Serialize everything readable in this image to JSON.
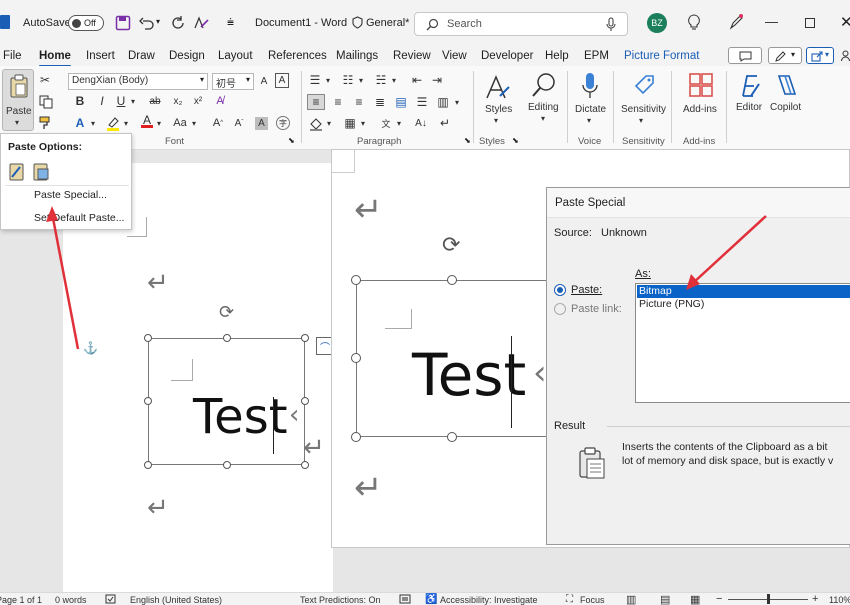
{
  "titlebar": {
    "autosave_label": "AutoSave",
    "autosave_state": "Off",
    "doc_title": "Document1 - Word",
    "sensitivity": "General*",
    "search_placeholder": "Search",
    "avatar_initials": "BZ"
  },
  "menu": {
    "tabs": [
      "File",
      "Home",
      "Insert",
      "Draw",
      "Design",
      "Layout",
      "References",
      "Mailings",
      "Review",
      "View",
      "Developer",
      "Help",
      "EPM",
      "Picture Format"
    ],
    "active_tab": "Home"
  },
  "ribbon": {
    "paste_label": "Paste",
    "font_name": "DengXian (Body)",
    "font_size": "初号",
    "group_font": "Font",
    "group_paragraph": "Paragraph",
    "group_styles": "Styles",
    "group_voice": "Voice",
    "group_sensitivity": "Sensitivity",
    "group_addins": "Add-ins",
    "styles_label": "Styles",
    "editing_label": "Editing",
    "dictate_label": "Dictate",
    "sensitivity_label": "Sensitivity",
    "addins_label": "Add-ins",
    "editor_label": "Editor",
    "copilot_label": "Copilot",
    "format_bold": "B",
    "format_italic": "I",
    "format_underline": "U"
  },
  "paste_menu": {
    "title": "Paste Options:",
    "items": [
      "Paste Special...",
      "Set Default Paste..."
    ]
  },
  "document": {
    "text_left": "Test",
    "text_right": "Test"
  },
  "dialog": {
    "title": "Paste Special",
    "source_label": "Source:",
    "source_value": "Unknown",
    "as_label": "As:",
    "paste_option": "Paste:",
    "paste_link_option": "Paste link:",
    "formats": [
      "Bitmap",
      "Picture (PNG)"
    ],
    "selected_format": "Bitmap",
    "result_label": "Result",
    "result_text_line1": "Inserts the contents of the Clipboard as a bit",
    "result_text_line2": "lot of memory and disk space, but is exactly v"
  },
  "status": {
    "page": "Page 1 of 1",
    "words": "0 words",
    "language": "English (United States)",
    "text_predictions": "Text Predictions: On",
    "accessibility": "Accessibility: Investigate",
    "focus": "Focus",
    "zoom": "110%"
  },
  "colors": {
    "accent": "#1b5eb6",
    "annotation_arrow": "#e0303a",
    "avatar": "#1a7f5a",
    "selection": "#0a64c8"
  }
}
